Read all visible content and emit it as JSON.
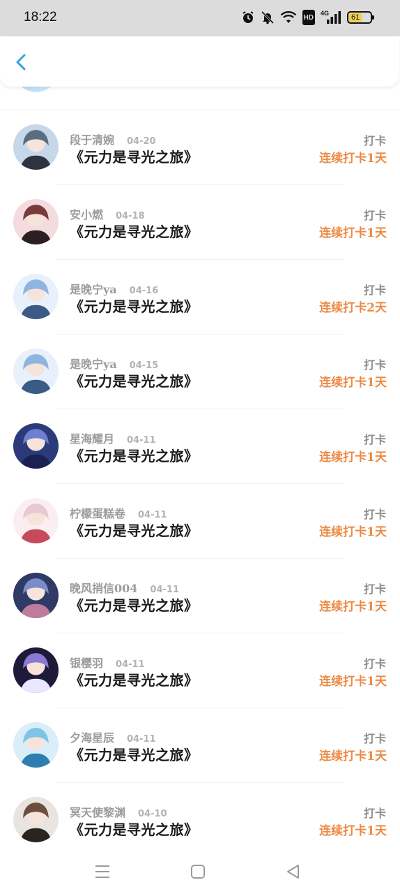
{
  "status_bar": {
    "time": "18:22",
    "network_label": "4G",
    "hd_label": "HD",
    "battery_level": "61",
    "icons": [
      "alarm-icon",
      "mute-bell-icon",
      "wifi-icon",
      "hd-icon",
      "signal-icon",
      "battery-icon"
    ]
  },
  "header": {
    "back_icon": "chevron-left-icon",
    "accent": "#3aa0e0"
  },
  "list": {
    "items": [
      {
        "name": "段于清婉",
        "date": "04-20",
        "title": "《元力是寻光之旅》",
        "action": "打卡",
        "streak": "连续打卡1天"
      },
      {
        "name": "安小燃",
        "date": "04-18",
        "title": "《元力是寻光之旅》",
        "action": "打卡",
        "streak": "连续打卡1天"
      },
      {
        "name": "是晚宁ya",
        "date": "04-16",
        "title": "《元力是寻光之旅》",
        "action": "打卡",
        "streak": "连续打卡2天"
      },
      {
        "name": "是晚宁ya",
        "date": "04-15",
        "title": "《元力是寻光之旅》",
        "action": "打卡",
        "streak": "连续打卡1天"
      },
      {
        "name": "星海耀月",
        "date": "04-11",
        "title": "《元力是寻光之旅》",
        "action": "打卡",
        "streak": "连续打卡1天"
      },
      {
        "name": "柠檬蛋糕卷",
        "date": "04-11",
        "title": "《元力是寻光之旅》",
        "action": "打卡",
        "streak": "连续打卡1天"
      },
      {
        "name": "晚风捎信004",
        "date": "04-11",
        "title": "《元力是寻光之旅》",
        "action": "打卡",
        "streak": "连续打卡1天"
      },
      {
        "name": "银樱羽",
        "date": "04-11",
        "title": "《元力是寻光之旅》",
        "action": "打卡",
        "streak": "连续打卡1天"
      },
      {
        "name": "夕海星辰",
        "date": "04-11",
        "title": "《元力是寻光之旅》",
        "action": "打卡",
        "streak": "连续打卡1天"
      },
      {
        "name": "冥天使黎渊",
        "date": "04-10",
        "title": "《元力是寻光之旅》",
        "action": "打卡",
        "streak": "连续打卡1天"
      }
    ]
  },
  "colors": {
    "streak": "#ec8a44",
    "name": "#9c9c9c",
    "title": "#1b1b1b"
  },
  "nav_bar": {
    "icons": [
      "menu-icon",
      "home-square-icon",
      "back-triangle-icon"
    ]
  }
}
